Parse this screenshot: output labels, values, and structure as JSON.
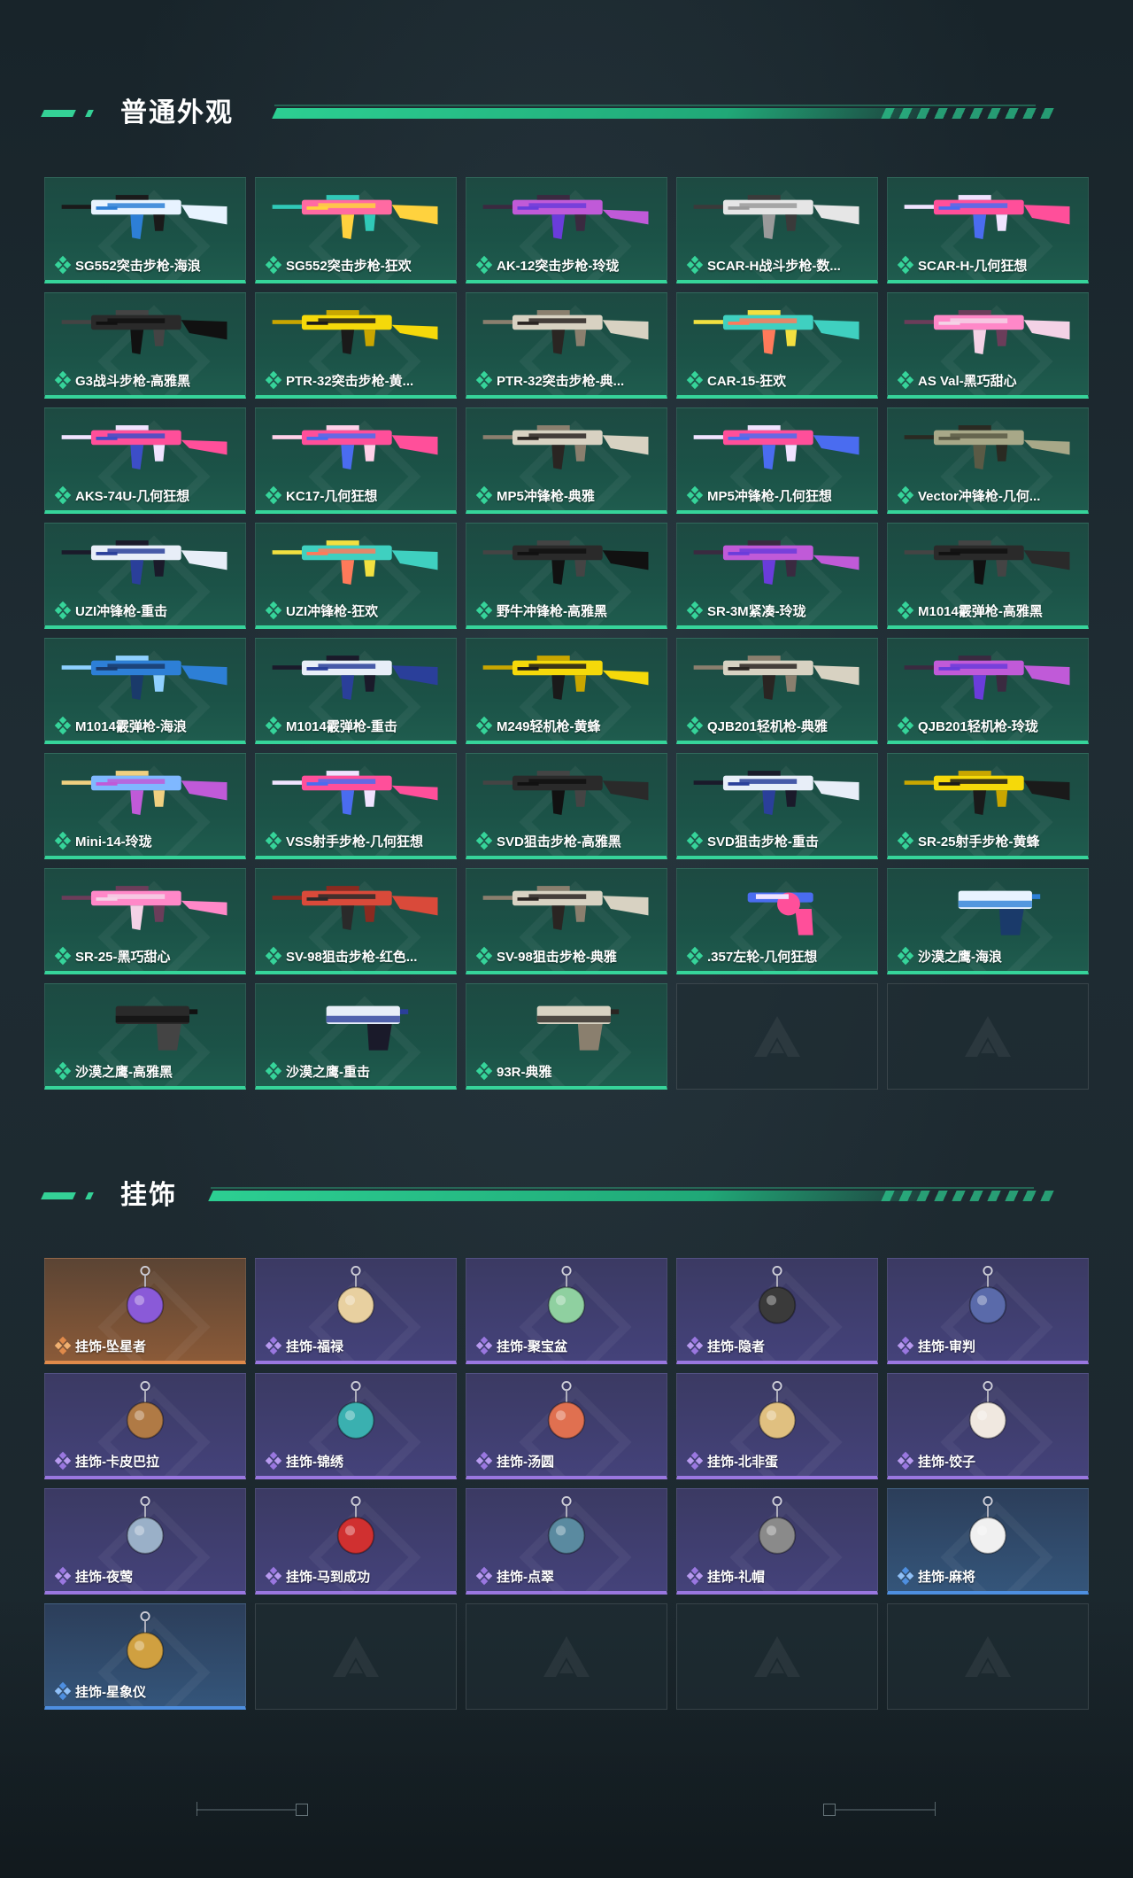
{
  "sections": {
    "weapons_title": "普通外观",
    "charms_title": "挂饰"
  },
  "weapons": [
    {
      "name": "SG552突击步枪-海浪",
      "colors": [
        "#e8f3ff",
        "#2d7fd6",
        "#1a1a1a"
      ]
    },
    {
      "name": "SG552突击步枪-狂欢",
      "colors": [
        "#ff6aa2",
        "#ffd23e",
        "#30c9b8"
      ]
    },
    {
      "name": "AK-12突击步枪-玲珑",
      "colors": [
        "#c05ad8",
        "#6a3cdb",
        "#3a2a40"
      ]
    },
    {
      "name": "SCAR-H战斗步枪-数...",
      "colors": [
        "#e6e6e6",
        "#9a9a9a",
        "#3a3a3a"
      ]
    },
    {
      "name": "SCAR-H-几何狂想",
      "colors": [
        "#ff4f9a",
        "#4a6cf0",
        "#f0e3ff"
      ]
    },
    {
      "name": "G3战斗步枪-高雅黑",
      "colors": [
        "#2a2a2a",
        "#111111",
        "#444444"
      ]
    },
    {
      "name": "PTR-32突击步枪-黄...",
      "colors": [
        "#f5d90a",
        "#1a1a1a",
        "#c9a600"
      ]
    },
    {
      "name": "PTR-32突击步枪-典...",
      "colors": [
        "#d8d2c2",
        "#2a2522",
        "#8a7f6e"
      ]
    },
    {
      "name": "CAR-15-狂欢",
      "colors": [
        "#3fd0c0",
        "#ff7a5a",
        "#f2e040"
      ]
    },
    {
      "name": "AS Val-黑巧甜心",
      "colors": [
        "#ff88c8",
        "#f4d2e6",
        "#6b3d5a"
      ]
    },
    {
      "name": "AKS-74U-几何狂想",
      "colors": [
        "#ff4f9a",
        "#3c4ec8",
        "#f0e3ff"
      ]
    },
    {
      "name": "KC17-几何狂想",
      "colors": [
        "#ff4f9a",
        "#4a6cf0",
        "#ffd0e8"
      ]
    },
    {
      "name": "MP5冲锋枪-典雅",
      "colors": [
        "#d8d2c2",
        "#2a2522",
        "#8a7f6e"
      ]
    },
    {
      "name": "MP5冲锋枪-几何狂想",
      "colors": [
        "#ff4f9a",
        "#4a6cf0",
        "#f0e3ff"
      ]
    },
    {
      "name": "Vector冲锋枪-几何...",
      "colors": [
        "#a8a888",
        "#5a5a45",
        "#2a2a22"
      ]
    },
    {
      "name": "UZI冲锋枪-重击",
      "colors": [
        "#e8eef8",
        "#2a3f9a",
        "#1a1a2a"
      ]
    },
    {
      "name": "UZI冲锋枪-狂欢",
      "colors": [
        "#3fd0c0",
        "#ff7a5a",
        "#f2e040"
      ]
    },
    {
      "name": "野牛冲锋枪-高雅黑",
      "colors": [
        "#2a2a2a",
        "#111111",
        "#444444"
      ]
    },
    {
      "name": "SR-3M紧凑-玲珑",
      "colors": [
        "#c05ad8",
        "#6a3cdb",
        "#3a2a40"
      ]
    },
    {
      "name": "M1014霰弹枪-高雅黑",
      "colors": [
        "#2a2a2a",
        "#111111",
        "#444444"
      ]
    },
    {
      "name": "M1014霰弹枪-海浪",
      "colors": [
        "#2d7fd6",
        "#1a3a6a",
        "#8fd0ff"
      ]
    },
    {
      "name": "M1014霰弹枪-重击",
      "colors": [
        "#e8eef8",
        "#2a3f9a",
        "#1a1a2a"
      ]
    },
    {
      "name": "M249轻机枪-黄蜂",
      "colors": [
        "#f5d90a",
        "#1a1a1a",
        "#c9a600"
      ]
    },
    {
      "name": "QJB201轻机枪-典雅",
      "colors": [
        "#d8d2c2",
        "#2a2522",
        "#8a7f6e"
      ]
    },
    {
      "name": "QJB201轻机枪-玲珑",
      "colors": [
        "#c05ad8",
        "#6a3cdb",
        "#3a2a40"
      ]
    },
    {
      "name": "Mini-14-玲珑",
      "colors": [
        "#7fb8ff",
        "#c05ad8",
        "#f0d080"
      ]
    },
    {
      "name": "VSS射手步枪-几何狂想",
      "colors": [
        "#ff4f9a",
        "#4a6cf0",
        "#f0e3ff"
      ]
    },
    {
      "name": "SVD狙击步枪-高雅黑",
      "colors": [
        "#2a2a2a",
        "#111111",
        "#444444"
      ]
    },
    {
      "name": "SVD狙击步枪-重击",
      "colors": [
        "#e8eef8",
        "#2a3f9a",
        "#1a1a2a"
      ]
    },
    {
      "name": "SR-25射手步枪-黄蜂",
      "colors": [
        "#f5d90a",
        "#1a1a1a",
        "#c9a600"
      ]
    },
    {
      "name": "SR-25-黑巧甜心",
      "colors": [
        "#ff88c8",
        "#f4d2e6",
        "#6b3d5a"
      ]
    },
    {
      "name": "SV-98狙击步枪-红色...",
      "colors": [
        "#d94a3a",
        "#2a2a2a",
        "#8a2a20"
      ]
    },
    {
      "name": "SV-98狙击步枪-典雅",
      "colors": [
        "#d8d2c2",
        "#2a2522",
        "#8a7f6e"
      ]
    },
    {
      "name": ".357左轮-几何狂想",
      "colors": [
        "#ff4f9a",
        "#4a6cf0",
        "#f0e3ff"
      ]
    },
    {
      "name": "沙漠之鹰-海浪",
      "colors": [
        "#e8f3ff",
        "#2d7fd6",
        "#1a3a6a"
      ]
    },
    {
      "name": "沙漠之鹰-高雅黑",
      "colors": [
        "#2a2a2a",
        "#111111",
        "#444444"
      ]
    },
    {
      "name": "沙漠之鹰-重击",
      "colors": [
        "#e8eef8",
        "#2a3f9a",
        "#1a1a2a"
      ]
    },
    {
      "name": "93R-典雅",
      "colors": [
        "#d8d2c2",
        "#2a2522",
        "#8a7f6e"
      ]
    }
  ],
  "charms": [
    {
      "name": "挂饰-坠星者",
      "rarity": "orange",
      "color": "#8a5ad8"
    },
    {
      "name": "挂饰-福禄",
      "rarity": "purple",
      "color": "#e8d0a0"
    },
    {
      "name": "挂饰-聚宝盆",
      "rarity": "purple",
      "color": "#8fd0a0"
    },
    {
      "name": "挂饰-隐者",
      "rarity": "purple",
      "color": "#3a3a3a"
    },
    {
      "name": "挂饰-审判",
      "rarity": "purple",
      "color": "#5a6aaa"
    },
    {
      "name": "挂饰-卡皮巴拉",
      "rarity": "purple",
      "color": "#b07a45"
    },
    {
      "name": "挂饰-锦绣",
      "rarity": "purple",
      "color": "#3ab0b0"
    },
    {
      "name": "挂饰-汤圆",
      "rarity": "purple",
      "color": "#e07050"
    },
    {
      "name": "挂饰-北非蛋",
      "rarity": "purple",
      "color": "#e0c080"
    },
    {
      "name": "挂饰-饺子",
      "rarity": "purple",
      "color": "#f0e8e0"
    },
    {
      "name": "挂饰-夜莺",
      "rarity": "purple",
      "color": "#9ab0c8"
    },
    {
      "name": "挂饰-马到成功",
      "rarity": "purple",
      "color": "#d03030"
    },
    {
      "name": "挂饰-点翠",
      "rarity": "purple",
      "color": "#5a8aa0"
    },
    {
      "name": "挂饰-礼帽",
      "rarity": "purple",
      "color": "#8a8a8a"
    },
    {
      "name": "挂饰-麻将",
      "rarity": "blue",
      "color": "#f0f0f0"
    },
    {
      "name": "挂饰-星象仪",
      "rarity": "blue",
      "color": "#d0a040"
    }
  ],
  "empty_slots": {
    "weapons": 2,
    "charms": 4
  },
  "theme": {
    "accent": "#34d196",
    "weapon_card_bottom": "#36d49a",
    "charm_purple": "#9a77e0",
    "charm_orange": "#e08a4a",
    "charm_blue": "#4e8fe0"
  }
}
